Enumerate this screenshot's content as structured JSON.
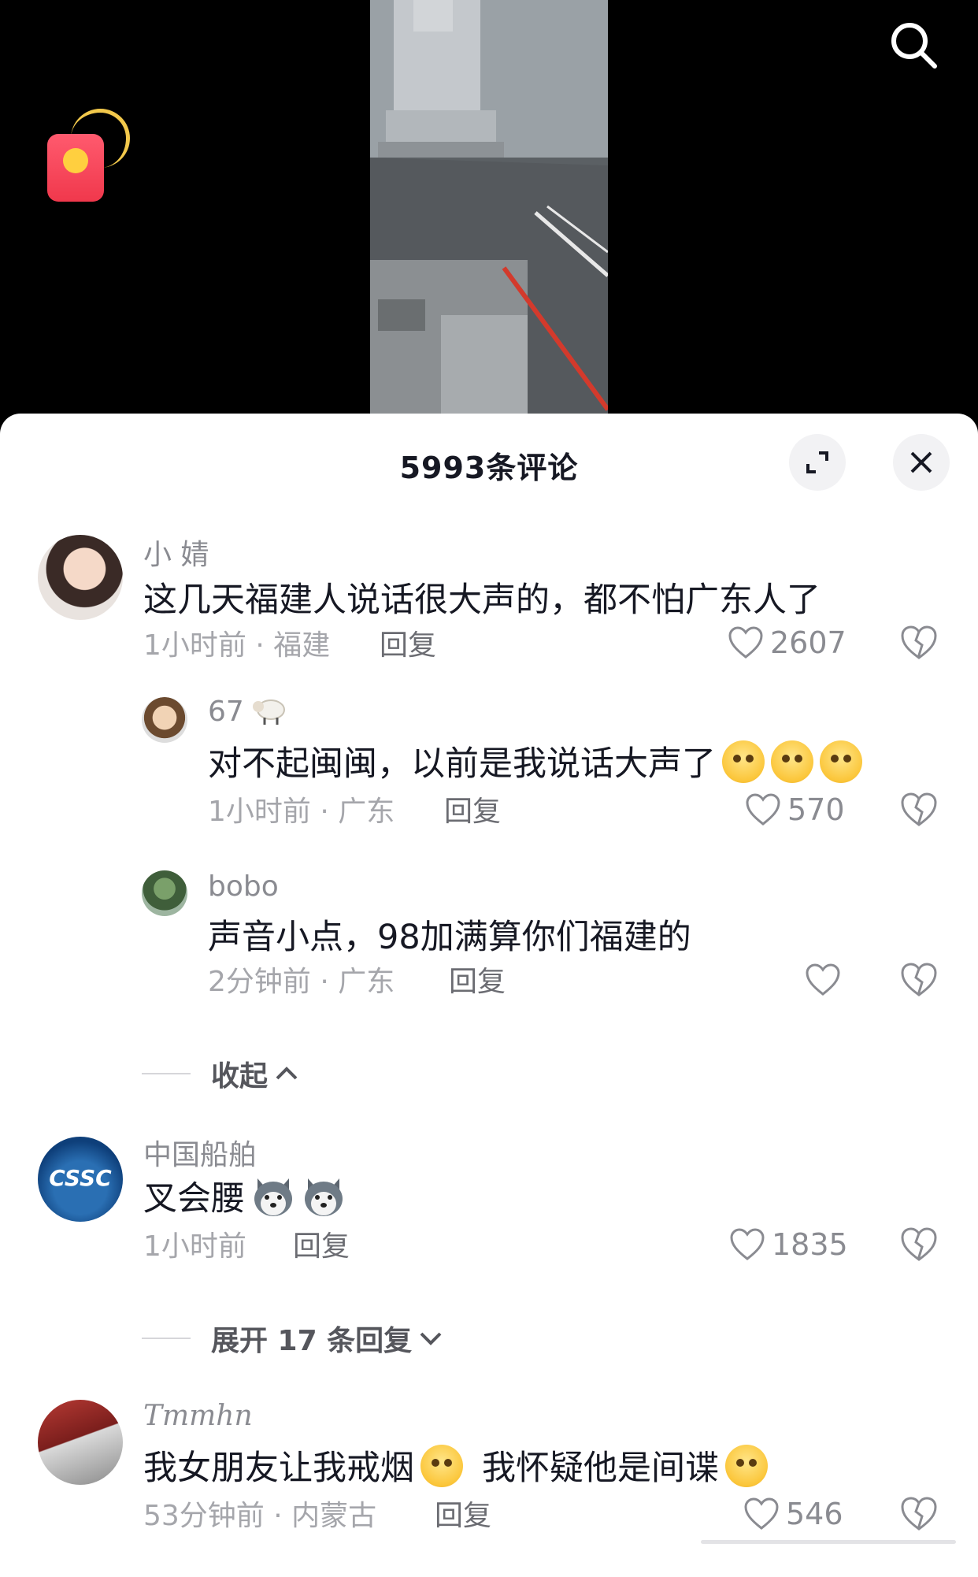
{
  "header": {
    "title": "5993条评论"
  },
  "comments": [
    {
      "name": "小 婧",
      "text": "这几天福建人说话很大声的，都不怕广东人了",
      "meta": "1小时前 · 福建",
      "reply": "回复",
      "likes": "2607"
    },
    {
      "name": "67",
      "text": "对不起闽闽，以前是我说话大声了",
      "meta": "1小时前 · 广东",
      "reply": "回复",
      "likes": "570"
    },
    {
      "name": "bobo",
      "text": "声音小点，98加满算你们福建的",
      "meta": "2分钟前 · 广东",
      "reply": "回复",
      "likes": ""
    },
    {
      "name": "中国船舶",
      "text": "叉会腰",
      "meta": "1小时前",
      "reply": "回复",
      "likes": "1835",
      "avatar_text": "CSSC"
    },
    {
      "name": "Tmmhn",
      "text": "我女朋友让我戒烟",
      "text2": "我怀疑他是间谍",
      "meta": "53分钟前 · 内蒙古",
      "reply": "回复",
      "likes": "546"
    }
  ],
  "collapse_label": "收起",
  "expand_label": "展开 17 条回复",
  "icons": [
    "search-icon",
    "red-packet-icon",
    "expand-icon",
    "close-icon",
    "heart-icon",
    "broken-heart-icon",
    "chevron-up-icon",
    "chevron-down-icon"
  ],
  "colors": {
    "text": "#161823",
    "secondary": "#8a8b91",
    "sheet": "#ffffff",
    "background": "#000000"
  }
}
